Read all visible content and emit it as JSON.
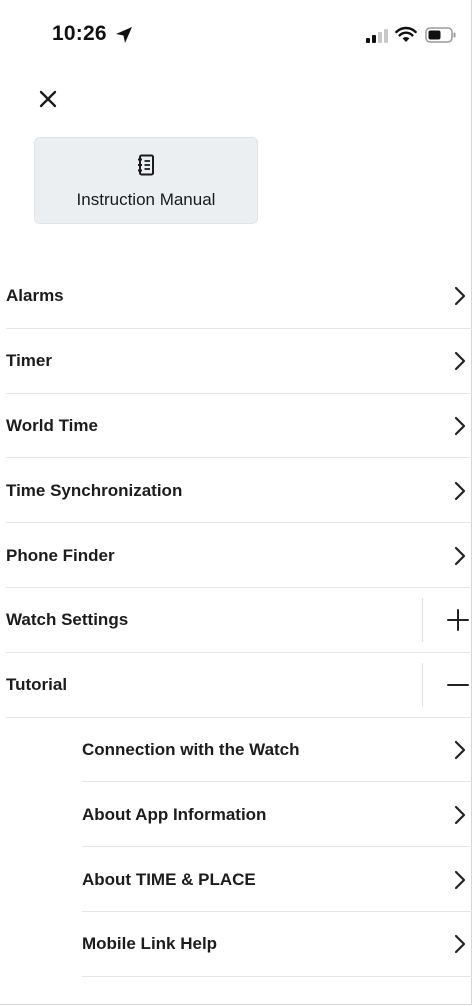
{
  "status_bar": {
    "time": "10:26",
    "icons": [
      "location-arrow-icon",
      "cellular-signal-icon",
      "wifi-icon",
      "battery-icon"
    ]
  },
  "header": {
    "close_icon": "close-icon"
  },
  "manual_card": {
    "icon": "notebook-icon",
    "label": "Instruction Manual"
  },
  "menu": {
    "items": [
      {
        "label": "Alarms",
        "control": "chevron-right-icon"
      },
      {
        "label": "Timer",
        "control": "chevron-right-icon"
      },
      {
        "label": "World Time",
        "control": "chevron-right-icon"
      },
      {
        "label": "Time Synchronization",
        "control": "chevron-right-icon"
      },
      {
        "label": "Phone Finder",
        "control": "chevron-right-icon"
      },
      {
        "label": "Watch Settings",
        "control": "plus-icon",
        "expanded": false
      },
      {
        "label": "Tutorial",
        "control": "minus-icon",
        "expanded": true
      }
    ],
    "tutorial_subitems": [
      {
        "label": "Connection with the Watch",
        "control": "chevron-right-icon"
      },
      {
        "label": "About App Information",
        "control": "chevron-right-icon"
      },
      {
        "label": "About TIME & PLACE",
        "control": "chevron-right-icon"
      },
      {
        "label": "Mobile Link Help",
        "control": "chevron-right-icon"
      }
    ]
  },
  "colors": {
    "card_background": "#eceff2",
    "divider": "#e6e6e6",
    "text": "#1c1c1c"
  }
}
